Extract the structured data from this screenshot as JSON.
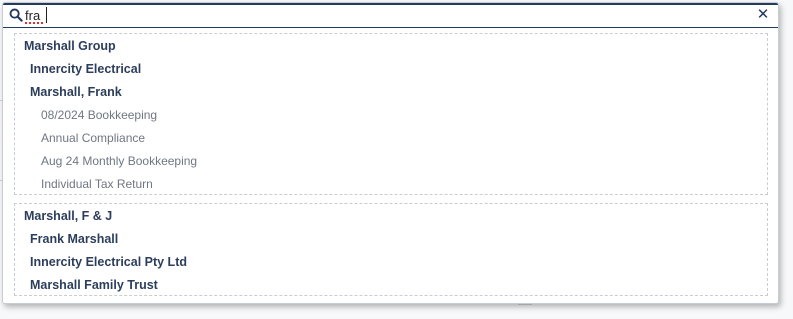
{
  "search": {
    "query": "fra",
    "close_symbol": "✕"
  },
  "groups": [
    {
      "items": [
        {
          "label": "Marshall Group",
          "level": 0
        },
        {
          "label": "Innercity Electrical",
          "level": 1
        },
        {
          "label": "Marshall, Frank",
          "level": 1
        },
        {
          "label": "08/2024 Bookkeeping",
          "level": 2
        },
        {
          "label": "Annual Compliance",
          "level": 2
        },
        {
          "label": "Aug 24 Monthly Bookkeeping",
          "level": 2
        },
        {
          "label": "Individual Tax Return",
          "level": 2
        }
      ]
    },
    {
      "items": [
        {
          "label": "Marshall, F & J",
          "level": 0
        },
        {
          "label": "Frank Marshall",
          "level": 1
        },
        {
          "label": "Innercity Electrical Pty Ltd",
          "level": 1
        },
        {
          "label": "Marshall Family Trust",
          "level": 1
        }
      ]
    }
  ],
  "colors": {
    "header_border": "#243a5e",
    "entity_text": "#2c3e5c",
    "job_text": "#6f7782",
    "dashed_border": "#c9cdd2"
  }
}
